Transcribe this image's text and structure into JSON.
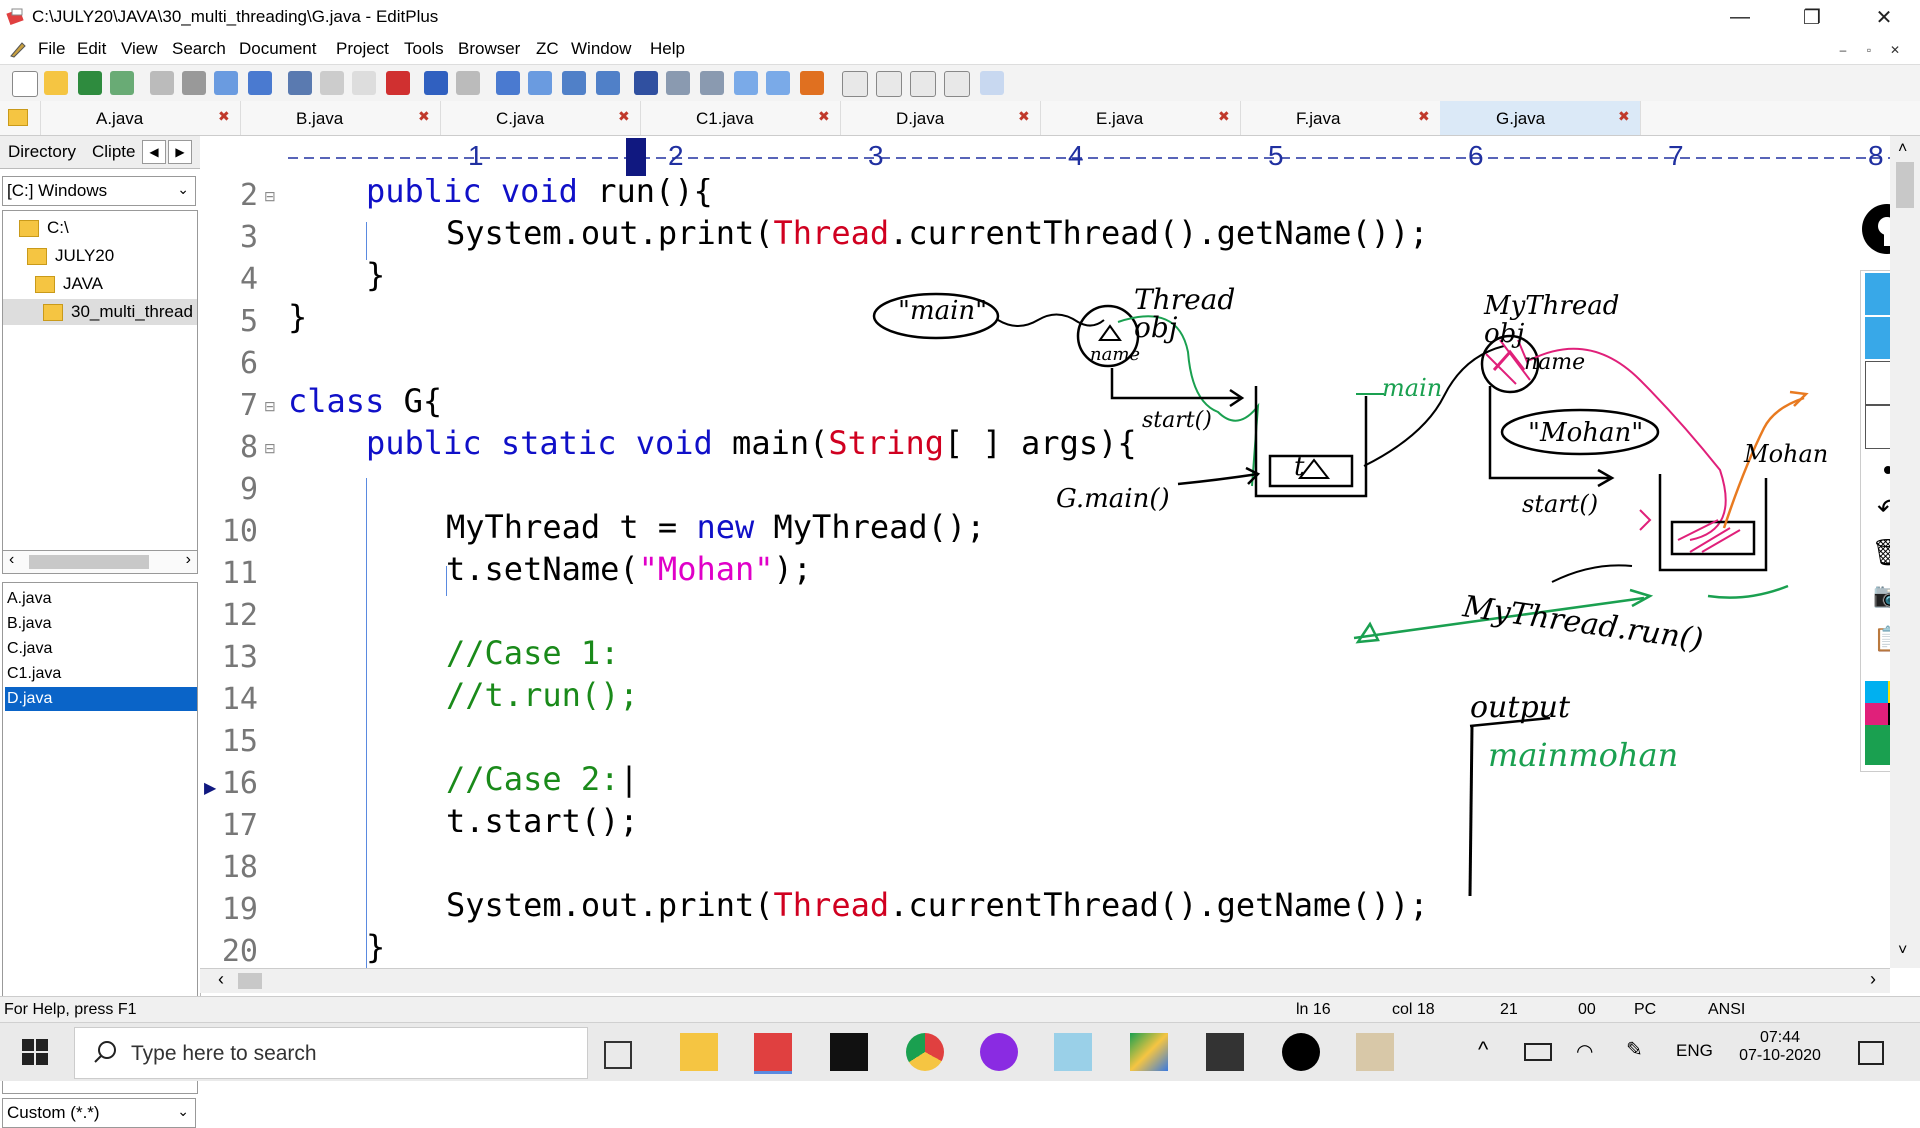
{
  "window": {
    "title": "C:\\JULY20\\JAVA\\30_multi_threading\\G.java - EditPlus",
    "minimize": "—",
    "maximize": "❐",
    "close": "✕"
  },
  "menu": [
    "File",
    "Edit",
    "View",
    "Search",
    "Document",
    "Project",
    "Tools",
    "Browser",
    "ZC",
    "Window",
    "Help"
  ],
  "tabs": [
    {
      "label": "A.java",
      "active": false
    },
    {
      "label": "B.java",
      "active": false
    },
    {
      "label": "C.java",
      "active": false
    },
    {
      "label": "C1.java",
      "active": false
    },
    {
      "label": "D.java",
      "active": false
    },
    {
      "label": "E.java",
      "active": false
    },
    {
      "label": "F.java",
      "active": false
    },
    {
      "label": "G.java",
      "active": true
    }
  ],
  "sidebar": {
    "tab_directory": "Directory",
    "tab_cliptext": "Clipte",
    "drive": "[C:] Windows",
    "tree": [
      "C:\\",
      "JULY20",
      "JAVA",
      "30_multi_thread"
    ],
    "files": [
      "A.java",
      "B.java",
      "C.java",
      "C1.java",
      "D.java"
    ],
    "selected_file": "D.java",
    "filter": "Custom (*.*)"
  },
  "ruler": {
    "marks": [
      "1",
      "2",
      "3",
      "4",
      "5",
      "6",
      "7",
      "8"
    ]
  },
  "editor": {
    "line_numbers": [
      "2",
      "3",
      "4",
      "5",
      "6",
      "7",
      "8",
      "9",
      "10",
      "11",
      "12",
      "13",
      "14",
      "15",
      "16",
      "17",
      "18",
      "19",
      "20"
    ],
    "current_line": "16"
  },
  "annotations": {
    "main_bubble": "\"main\"",
    "thread_obj": "Thread obj",
    "name": "name",
    "start1": "start()",
    "main_green": "main",
    "gmain": "G.main()",
    "t_label": "t",
    "mythread_obj": "MyThread obj",
    "name2": "name",
    "mohan_bubble": "\"Mohan\"",
    "start2": "start()",
    "mohan_label": "Mohan",
    "mythread_run": "MyThread.run()",
    "output": "output",
    "output_value": "mainmohan"
  },
  "status": {
    "help": "For Help, press F1",
    "ln": "ln 16",
    "col": "col 18",
    "count": "21",
    "zero": "00",
    "mode": "PC",
    "encoding": "ANSI"
  },
  "taskbar": {
    "search_placeholder": "Type here to search",
    "lang": "ENG",
    "time": "07:44",
    "date": "07-10-2020"
  },
  "colors": {
    "keyword": "#1010c8",
    "class": "#d00020",
    "string": "#e000c8",
    "comment": "#1a8a1a",
    "selection": "#0a64c8"
  }
}
